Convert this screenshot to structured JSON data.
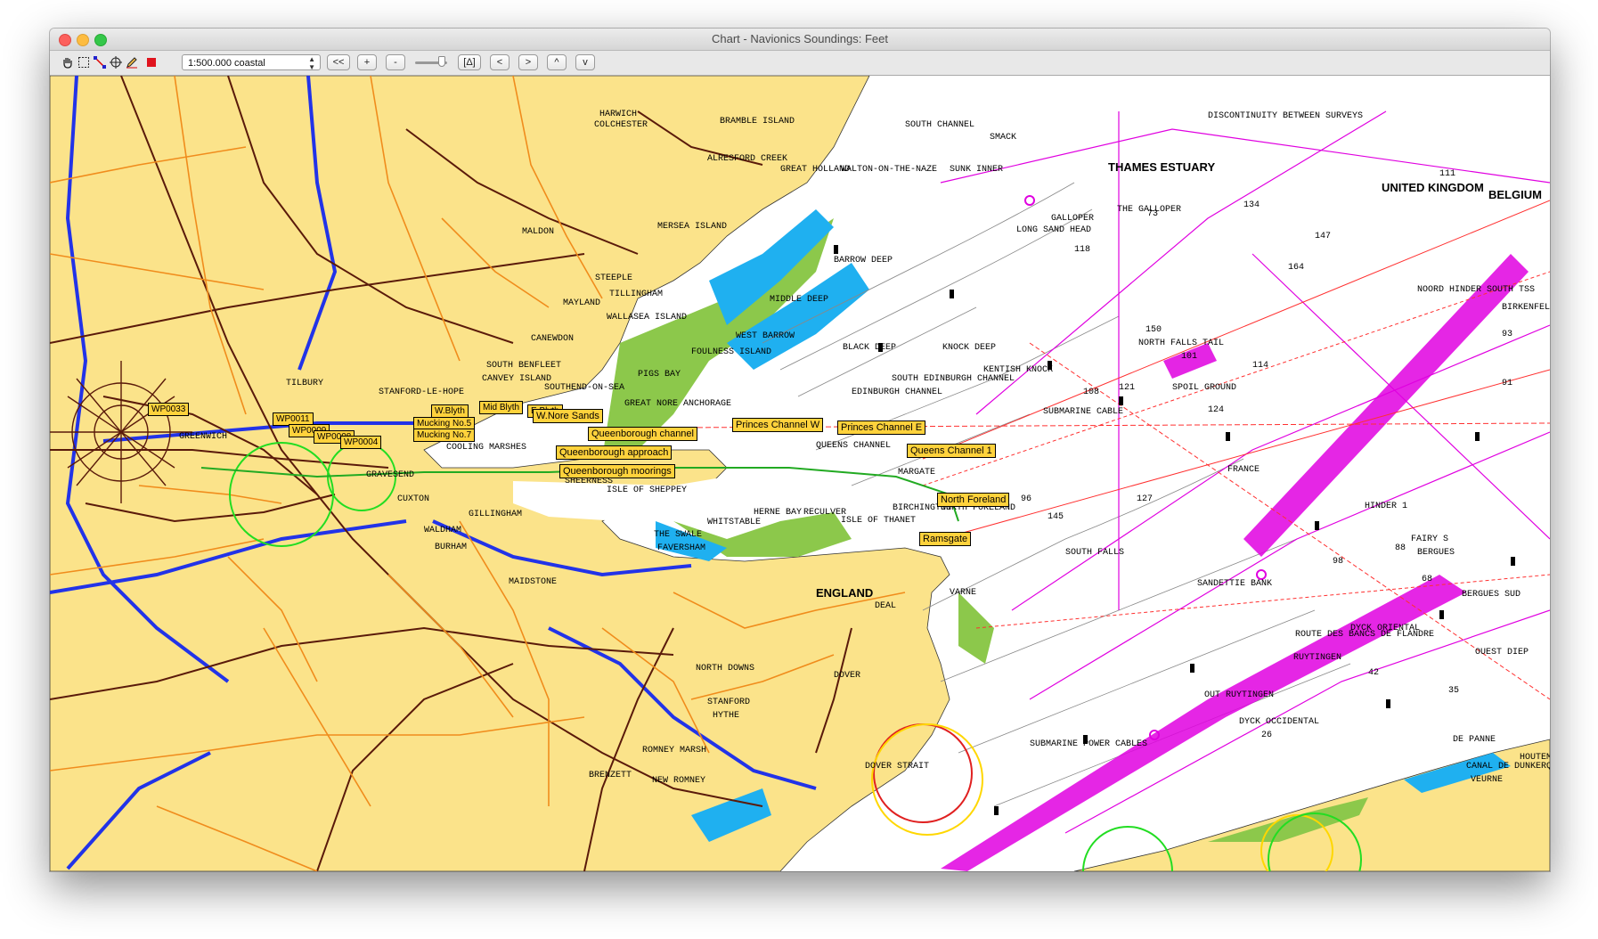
{
  "window": {
    "title": "Chart - Navionics  Soundings: Feet"
  },
  "toolbar": {
    "tools": [
      {
        "name": "hand-icon",
        "glyph": "✋"
      },
      {
        "name": "select-rect-icon",
        "glyph": "⬚"
      },
      {
        "name": "route-icon",
        "glyph": "⟋"
      },
      {
        "name": "crosshair-icon",
        "glyph": "⊕"
      },
      {
        "name": "pencil-icon",
        "glyph": "✎"
      },
      {
        "name": "stop-icon",
        "glyph": "■"
      }
    ],
    "scale_value": "1:500.000 coastal",
    "buttons": {
      "back": "<<",
      "zoom_in": "+",
      "zoom_out": "-",
      "delta": "[Δ]",
      "left": "<",
      "right": ">",
      "up": "^",
      "down": "v"
    }
  },
  "colors": {
    "land": "#fbe38a",
    "sea": "#ffffff",
    "shallow": "#1fb0f0",
    "drying": "#8cc84b",
    "motorway": "#2233e8",
    "road_major": "#5a1a0a",
    "road_minor": "#f08c1c",
    "nav": "#e000e0",
    "waypoint": "#ffd23c"
  },
  "map": {
    "place_labels": [
      "HARWICH",
      "COLCHESTER",
      "BRAMBLE ISLAND",
      "ALRESFORD CREEK",
      "GREAT HOLLAND",
      "WALTON-ON-THE-NAZE",
      "MALDON",
      "MERSEA ISLAND",
      "STEEPLE",
      "TILLINGHAM",
      "MAYLAND",
      "WALLASEA ISLAND",
      "CANEWDON",
      "SOUTH BENFLEET",
      "CANVEY ISLAND",
      "SOUTHEND-ON-SEA",
      "STANFORD-LE-HOPE",
      "TILBURY",
      "GRAVESEND",
      "COOLING MARSHES",
      "CUXTON",
      "GILLINGHAM",
      "WALDHAM",
      "BURHAM",
      "ISLE OF SHEPPEY",
      "SHEERNESS",
      "WHITSTABLE",
      "HERNE BAY",
      "RECULVER",
      "ISLE OF THANET",
      "BIRCHINGTON",
      "MARGATE",
      "FAVERSHAM",
      "THE SWALE",
      "MAIDSTONE",
      "ENGLAND",
      "DEAL",
      "DOVER",
      "NORTH DOWNS",
      "STANFORD",
      "HYTHE",
      "ROMNEY MARSH",
      "NEW ROMNEY",
      "BRENZETT",
      "GREENWICH",
      "GREAT NORE ANCHORAGE",
      "FOULNESS ISLAND",
      "PIGS BAY"
    ],
    "sea_labels": [
      "THAMES ESTUARY",
      "UNITED KINGDOM",
      "BELGIUM",
      "FRANCE",
      "SOUTH CHANNEL",
      "BARROW DEEP",
      "MIDDLE DEEP",
      "WEST BARROW",
      "BLACK DEEP",
      "KNOCK DEEP",
      "EDINBURGH CHANNEL",
      "QUEENS CHANNEL",
      "NORTH FALLS TAIL",
      "SPOIL GROUND",
      "SUBMARINE CABLE",
      "LONG SAND HEAD",
      "THE GALLOPER",
      "DISCONTINUITY BETWEEN SURVEYS",
      "NOORD HINDER SOUTH TSS",
      "BIRKENFELS",
      "SOUTH FALLS",
      "SANDETTIE BANK",
      "DYCK ORIENTAL",
      "RUYTINGEN",
      "DOVER STRAIT",
      "VARNE",
      "BERGUES",
      "FAIRY S",
      "HINDER 1",
      "BERGUES SUD",
      "OUEST DIEP",
      "CANAL DE DUNKERQUE",
      "VEURNE",
      "DE PANNE",
      "HOUTEM",
      "ROUTE DES BANCS DE FLANDRE",
      "DYCK OCCIDENTAL",
      "SUBMARINE POWER CABLES",
      "OUT RUYTINGEN",
      "SOUTH EDINBURGH CHANNEL",
      "NORTH FORELAND",
      "KENTISH KNOCK",
      "SUNK INNER",
      "GALLOPER",
      "SMACK"
    ],
    "waypoints": [
      "WP0033",
      "WP0011",
      "WP0009",
      "WP0008",
      "WP0004",
      "W.Blyth",
      "Mid Blyth",
      "E.Blyth",
      "Mucking No.5",
      "Mucking No.7",
      "W.Nore Sands",
      "Queenborough channel",
      "Queenborough approach",
      "Queenborough moorings",
      "Princes Channel W",
      "Princes Channel E",
      "Queens Channel 1",
      "North Foreland",
      "Ramsgate"
    ],
    "soundings_sample": [
      "73",
      "147",
      "134",
      "101",
      "118",
      "114",
      "124",
      "108",
      "121",
      "98",
      "111",
      "150",
      "127",
      "145",
      "164",
      "93",
      "88",
      "68",
      "42",
      "35",
      "26",
      "96",
      "91"
    ]
  }
}
